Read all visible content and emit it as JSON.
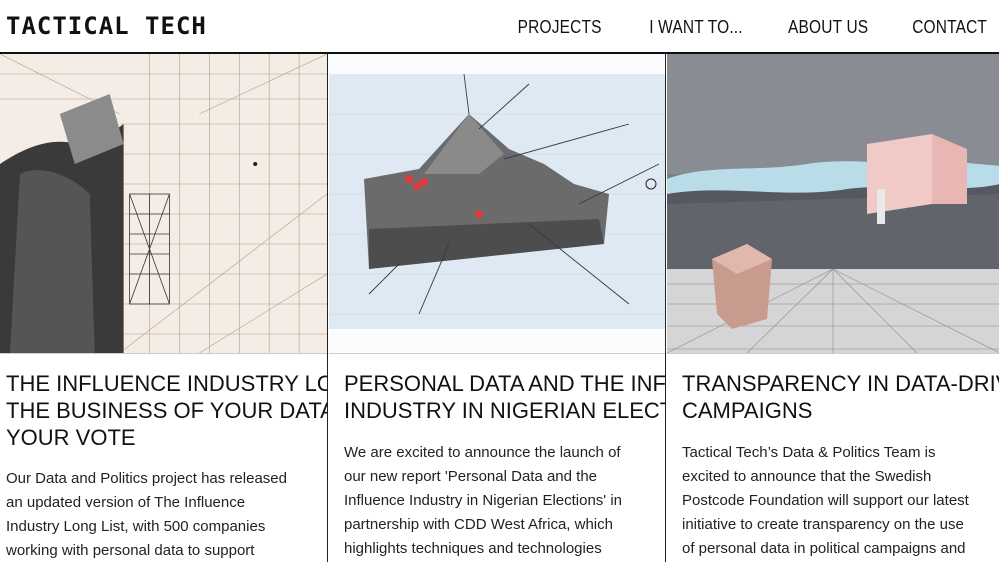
{
  "header": {
    "logo_text": "TACTICAL TECH",
    "nav": [
      "PROJECTS",
      "I WANT TO...",
      "ABOUT US",
      "CONTACT"
    ]
  },
  "cards": [
    {
      "title_lines": [
        "THE INFLUENCE INDUSTRY LONG LIST:",
        "THE BUSINESS OF YOUR DATA AND",
        "YOUR VOTE"
      ],
      "excerpt_lines": [
        "Our Data and Politics project has released",
        "an updated version of The Influence",
        "Industry Long List, with 500 companies",
        "working with personal data to support"
      ]
    },
    {
      "title_lines": [
        "PERSONAL DATA AND THE INFLUENCE",
        "INDUSTRY IN NIGERIAN ELECTIONS"
      ],
      "excerpt_lines": [
        "We are excited to announce the launch of",
        "our new report 'Personal Data and the",
        "Influence Industry in Nigerian Elections' in",
        "partnership with CDD West Africa, which",
        "highlights techniques and technologies"
      ]
    },
    {
      "title_lines": [
        "TRANSPARENCY IN DATA-DRIVEN",
        "CAMPAIGNS"
      ],
      "excerpt_lines": [
        "Tactical Tech’s Data & Politics Team is",
        "excited to announce that the Swedish",
        "Postcode Foundation will support our latest",
        "initiative to create transparency on the use",
        "of personal data in political campaigns and"
      ]
    }
  ],
  "colors": {
    "text": "#111111",
    "border": "#222222",
    "background": "#ffffff"
  }
}
